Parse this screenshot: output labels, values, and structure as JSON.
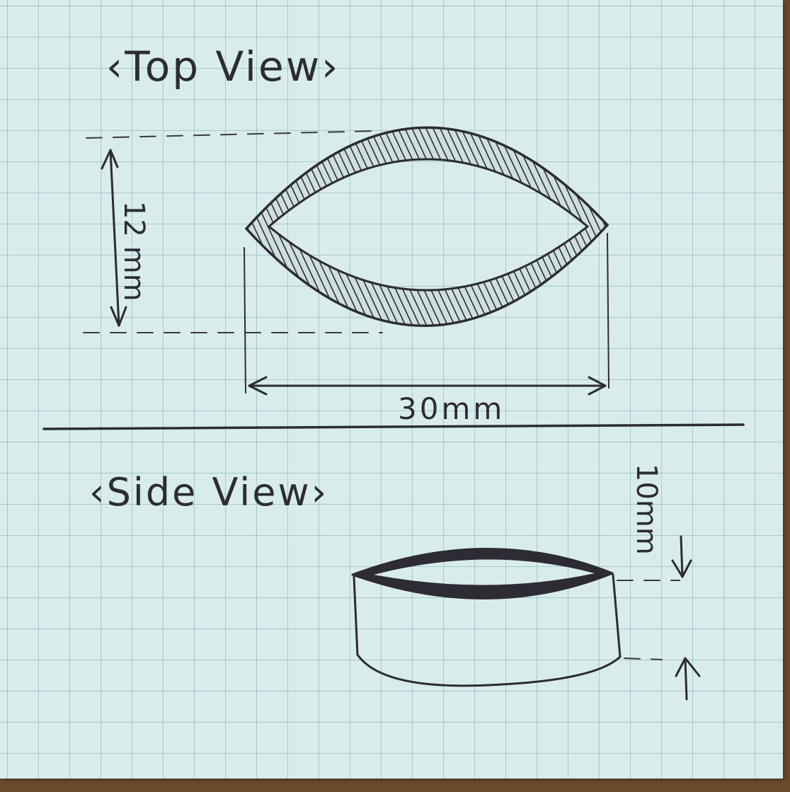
{
  "top_view": {
    "title": "‹Top View›",
    "height_label": "12 mm",
    "width_label": "30mm"
  },
  "side_view": {
    "title": "‹Side View›",
    "height_label": "10mm"
  },
  "colors": {
    "paper": "#d9ecec",
    "grid": "#78afb4",
    "ink": "#2d2b33",
    "table": "#6b4a2c"
  }
}
